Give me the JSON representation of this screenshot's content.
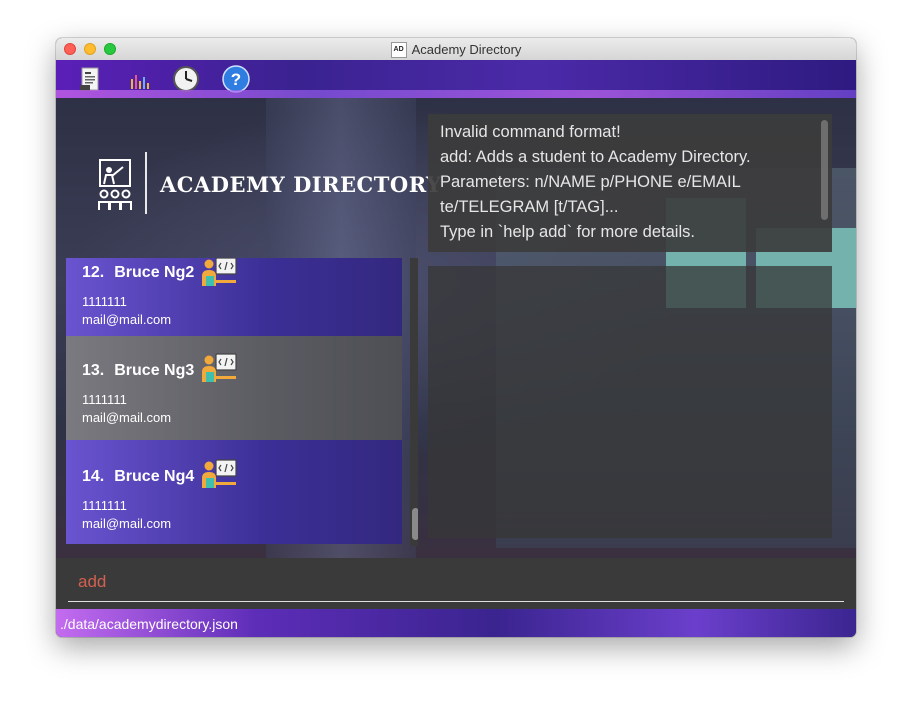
{
  "window": {
    "title": "Academy Directory",
    "title_icon_text": "AD"
  },
  "menubar": {
    "items": [
      {
        "name": "file-icon"
      },
      {
        "name": "chart-icon"
      },
      {
        "name": "clock-icon"
      },
      {
        "name": "help-icon",
        "glyph": "?"
      }
    ]
  },
  "logo": {
    "text": "ACADEMY DIRECTORY"
  },
  "result": {
    "lines": [
      "Invalid command format!",
      "add: Adds a student to Academy Directory.",
      "Parameters: n/NAME p/PHONE e/EMAIL",
      "te/TELEGRAM [t/TAG]...",
      "Type in `help add` for more details."
    ]
  },
  "students": [
    {
      "index": "12.",
      "name": "Bruce Ng2",
      "phone": "1111111",
      "email": "mail@mail.com",
      "style": "purple",
      "icon": "student-coding-icon"
    },
    {
      "index": "13.",
      "name": "Bruce Ng3",
      "phone": "1111111",
      "email": "mail@mail.com",
      "style": "grey",
      "icon": "student-coding-icon"
    },
    {
      "index": "14.",
      "name": "Bruce Ng4",
      "phone": "1111111",
      "email": "mail@mail.com",
      "style": "purple",
      "icon": "student-coding-icon"
    }
  ],
  "command": {
    "value": "add"
  },
  "status": {
    "path": "./data/academydirectory.json"
  },
  "colors": {
    "accent_purple": "#3b2f96",
    "command_text": "#d2604f",
    "selected_card": "#5b5b62"
  }
}
